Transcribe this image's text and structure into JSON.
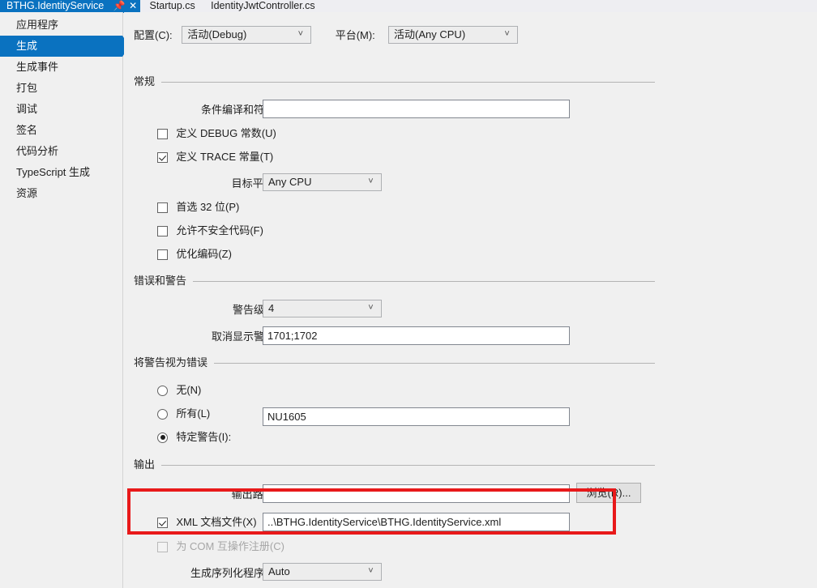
{
  "tabs": [
    {
      "label": "BTHG.IdentityService",
      "active": true,
      "pin_icon": "pin-icon",
      "close_icon": "close-icon"
    },
    {
      "label": "Startup.cs",
      "active": false
    },
    {
      "label": "IdentityJwtController.cs",
      "active": false
    }
  ],
  "sidebar": {
    "items": [
      {
        "label": "应用程序",
        "selected": false
      },
      {
        "label": "生成",
        "selected": true
      },
      {
        "label": "生成事件",
        "selected": false
      },
      {
        "label": "打包",
        "selected": false
      },
      {
        "label": "调试",
        "selected": false
      },
      {
        "label": "签名",
        "selected": false
      },
      {
        "label": "代码分析",
        "selected": false
      },
      {
        "label": "TypeScript 生成",
        "selected": false
      },
      {
        "label": "资源",
        "selected": false
      }
    ]
  },
  "config_bar": {
    "configuration_label": "配置(C):",
    "configuration_value": "活动(Debug)",
    "platform_label": "平台(M):",
    "platform_value": "活动(Any CPU)",
    "dropdown_icon": "chevron-down-icon"
  },
  "general": {
    "title": "常规",
    "conditional_symbols_label": "条件编译和符号(Y):",
    "conditional_symbols_value": "",
    "define_debug_label": "定义 DEBUG 常数(U)",
    "define_debug_checked": false,
    "define_trace_label": "定义 TRACE 常量(T)",
    "define_trace_checked": true,
    "target_platform_label": "目标平台(G):",
    "target_platform_value": "Any CPU",
    "prefer_32bit_label": "首选 32 位(P)",
    "prefer_32bit_checked": false,
    "allow_unsafe_label": "允许不安全代码(F)",
    "allow_unsafe_checked": false,
    "optimize_label": "优化编码(Z)",
    "optimize_checked": false
  },
  "errors_warnings": {
    "title": "错误和警告",
    "warning_level_label": "警告级别(A):",
    "warning_level_value": "4",
    "suppress_warnings_label": "取消显示警告(S):",
    "suppress_warnings_value": "1701;1702"
  },
  "warnings_as_errors": {
    "title": "将警告视为错误",
    "none_label": "无(N)",
    "none_selected": false,
    "all_label": "所有(L)",
    "all_selected": false,
    "specific_label": "特定警告(I):",
    "specific_selected": true,
    "specific_value": "NU1605"
  },
  "output": {
    "title": "输出",
    "output_path_label": "输出路径(O):",
    "output_path_value": "",
    "browse_label": "浏览(R)...",
    "xml_doc_label": "XML 文档文件(X)",
    "xml_doc_checked": true,
    "xml_doc_value": "..\\BTHG.IdentityService\\BTHG.IdentityService.xml",
    "register_com_label": "为 COM 互操作注册(C)",
    "register_com_checked": false,
    "serialization_label": "生成序列化程序集(E):",
    "serialization_value": "Auto"
  },
  "annotation": {
    "color": "#e8191a"
  }
}
